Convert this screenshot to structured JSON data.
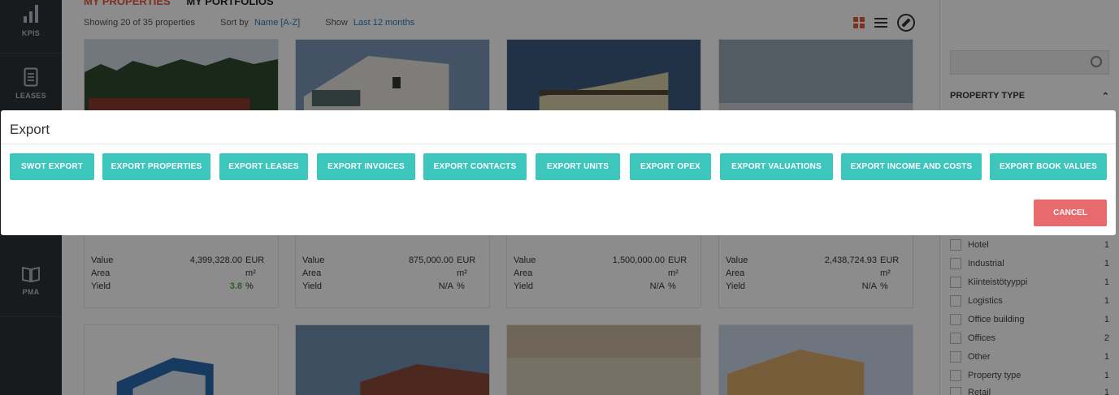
{
  "nav": {
    "items": [
      {
        "label": "KPIS",
        "icon": "bar-chart-icon"
      },
      {
        "label": "LEASES",
        "icon": "document-icon"
      },
      {
        "label": "PMA",
        "icon": "book-icon"
      }
    ]
  },
  "tabs": {
    "active": "MY PROPERTIES",
    "other": "MY PORTFOLIOS"
  },
  "toolbar": {
    "showing": "Showing 20 of 35 properties",
    "sort_label": "Sort by",
    "sort_value": "Name [A-Z]",
    "show_label": "Show",
    "show_value": "Last 12 months"
  },
  "cards": [
    {
      "value": "4,399,328.00",
      "value_unit": "EUR",
      "area_unit": "m²",
      "yield": "3.8",
      "yield_unit": "%"
    },
    {
      "value": "875,000.00",
      "value_unit": "EUR",
      "area_unit": "m²",
      "yield": "N/A",
      "yield_unit": "%"
    },
    {
      "value": "1,500,000.00",
      "value_unit": "EUR",
      "area_unit": "m²",
      "yield": "N/A",
      "yield_unit": "%"
    },
    {
      "value": "2,438,724.93",
      "value_unit": "EUR",
      "area_unit": "m²",
      "yield": "N/A",
      "yield_unit": "%"
    }
  ],
  "card_labels": {
    "value": "Value",
    "area": "Area",
    "yield": "Yield"
  },
  "filters": {
    "heading": "PROPERTY TYPE",
    "options": [
      {
        "label": "Hotel",
        "count": "1"
      },
      {
        "label": "Industrial",
        "count": "1"
      },
      {
        "label": "Kiinteistötyyppi",
        "count": "1"
      },
      {
        "label": "Logistics",
        "count": "1"
      },
      {
        "label": "Office building",
        "count": "1"
      },
      {
        "label": "Offices",
        "count": "2"
      },
      {
        "label": "Other",
        "count": "1"
      },
      {
        "label": "Property type",
        "count": "1"
      },
      {
        "label": "Retail",
        "count": "1"
      }
    ]
  },
  "modal": {
    "title": "Export",
    "buttons": [
      "SWOT EXPORT",
      "EXPORT PROPERTIES",
      "EXPORT LEASES",
      "EXPORT INVOICES",
      "EXPORT CONTACTS",
      "EXPORT UNITS",
      "EXPORT OPEX",
      "EXPORT VALUATIONS",
      "EXPORT INCOME AND COSTS",
      "EXPORT BOOK VALUES"
    ],
    "cancel": "CANCEL"
  },
  "colors": {
    "accent": "#e8553c",
    "export_button": "#3cc6bc",
    "cancel_button": "#e86a6d",
    "sidebar": "#2b3238",
    "positive_yield": "#5aa84c"
  }
}
